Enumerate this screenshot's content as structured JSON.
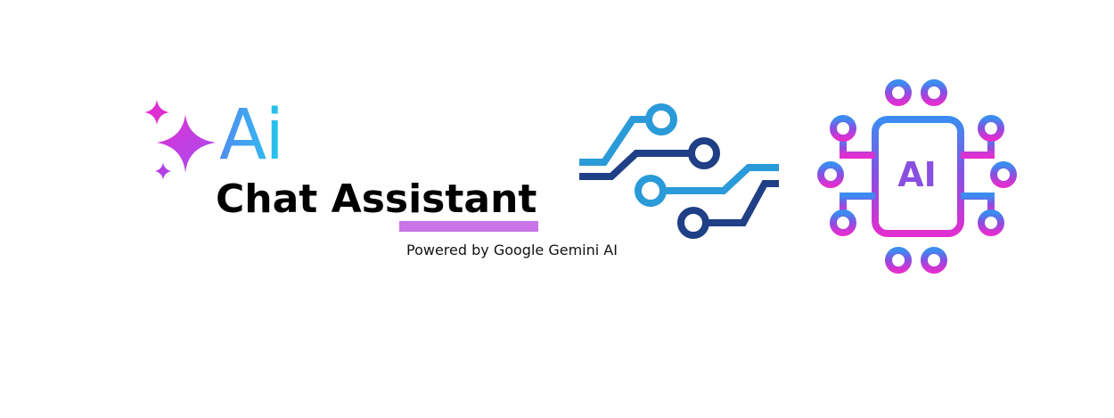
{
  "logo": {
    "ai_text": "Ai",
    "title": "Chat Assistant",
    "subtitle": "Powered by Google Gemini AI",
    "icon": "sparkles-icon",
    "colors": {
      "sparkle_pink": "#e02fd0",
      "sparkle_purple": "#a855f7",
      "ai_gradient_start": "#4f8cf0",
      "ai_gradient_end": "#22c8ec",
      "underline": "#c873e6"
    }
  },
  "circuit": {
    "icon": "circuit-lines-icon",
    "colors": {
      "light": "#2a9ad8",
      "dark": "#1f3f86"
    }
  },
  "chip": {
    "icon": "ai-chip-icon",
    "label": "AI",
    "colors": {
      "top": "#3b8cf0",
      "middle": "#8a4fe0",
      "bottom": "#e02fd0"
    }
  }
}
